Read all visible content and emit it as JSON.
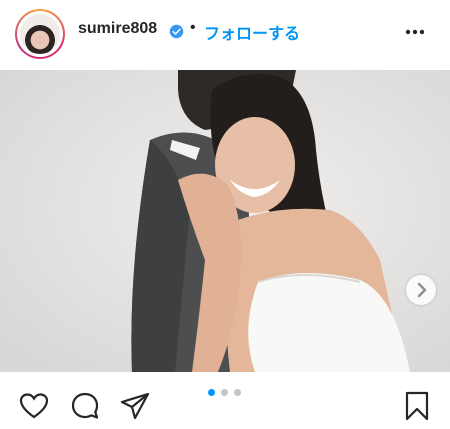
{
  "header": {
    "username": "sumire808",
    "separator": "•",
    "follow_label": "フォローする"
  },
  "icons": {
    "verified": "verified-badge-icon",
    "more": "more-options-icon",
    "like": "heart-icon",
    "comment": "comment-icon",
    "share": "paper-plane-icon",
    "save": "bookmark-icon",
    "next": "chevron-right-icon"
  },
  "carousel": {
    "total": 3,
    "active": 1
  },
  "colors": {
    "accent": "#0095f6",
    "text": "#262626",
    "pager_inactive": "#c4c4c4"
  }
}
